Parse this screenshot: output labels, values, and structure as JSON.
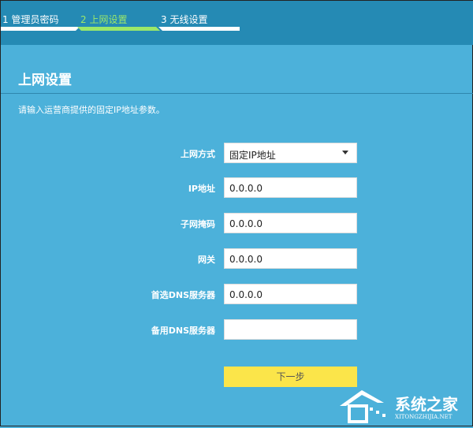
{
  "steps": [
    {
      "label": "1 管理员密码"
    },
    {
      "label": "2 上网设置"
    },
    {
      "label": "3 无线设置"
    }
  ],
  "title": "上网设置",
  "description": "请输入运营商提供的固定IP地址参数。",
  "form": {
    "connection_type": {
      "label": "上网方式",
      "value": "固定IP地址"
    },
    "ip": {
      "label": "IP地址",
      "value": "0.0.0.0"
    },
    "mask": {
      "label": "子网掩码",
      "value": "0.0.0.0"
    },
    "gateway": {
      "label": "网关",
      "value": "0.0.0.0"
    },
    "dns1": {
      "label": "首选DNS服务器",
      "value": "0.0.0.0"
    },
    "dns2": {
      "label": "备用DNS服务器",
      "value": ""
    }
  },
  "next_label": "下一步",
  "watermark": {
    "title": "系统之家",
    "sub": "XITONGZHIJIA.NET"
  },
  "colors": {
    "header": "#258ab4",
    "background": "#4cb1da",
    "active_step": "#9be86a",
    "button": "#fbe54a"
  }
}
